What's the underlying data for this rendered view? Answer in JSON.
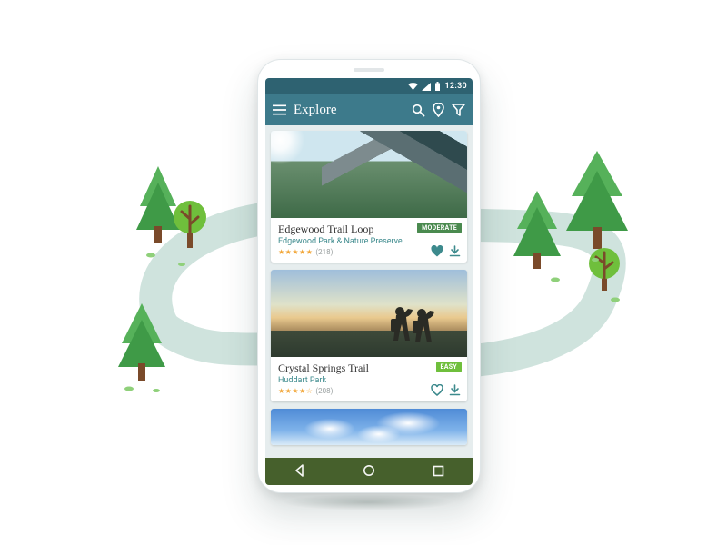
{
  "statusbar": {
    "time": "12:30"
  },
  "appbar": {
    "title": "Explore"
  },
  "trails": [
    {
      "title": "Edgewood Trail Loop",
      "subtitle": "Edgewood Park & Nature Preserve",
      "stars": "★★★★★",
      "count": "(218)",
      "difficulty_label": "MODERATE",
      "difficulty_class": "moderate",
      "favorite": true
    },
    {
      "title": "Crystal Springs Trail",
      "subtitle": "Huddart Park",
      "stars": "★★★★☆",
      "count": "(208)",
      "difficulty_label": "EASY",
      "difficulty_class": "easy",
      "favorite": false
    }
  ],
  "colors": {
    "appbar": "#3d7a8b",
    "statusbar": "#2e6271",
    "navbar": "#46602c",
    "accent": "#3d8a8d"
  }
}
